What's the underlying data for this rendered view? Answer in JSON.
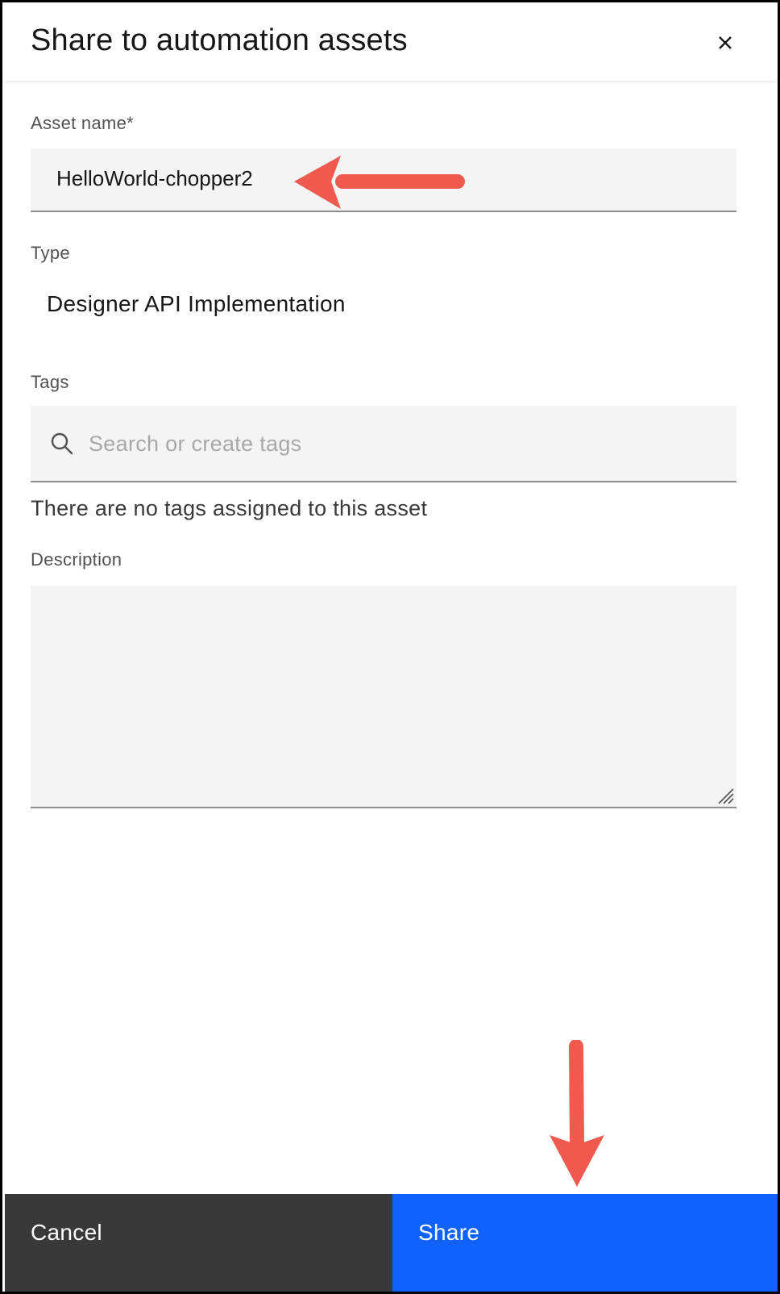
{
  "modal": {
    "title": "Share to automation assets",
    "close_icon": "close-icon"
  },
  "asset_name": {
    "label": "Asset name*",
    "value": "HelloWorld-chopper2"
  },
  "type": {
    "label": "Type",
    "value": "Designer API Implementation"
  },
  "tags": {
    "label": "Tags",
    "placeholder": "Search or create tags",
    "search_icon": "search-icon",
    "empty_message": "There are no tags assigned to this asset"
  },
  "description": {
    "label": "Description",
    "value": ""
  },
  "footer": {
    "cancel_label": "Cancel",
    "share_label": "Share"
  },
  "colors": {
    "primary": "#0f62fe",
    "secondary": "#393939",
    "field_bg": "#f4f4f4",
    "annotation_arrow": "#f05a4e"
  }
}
